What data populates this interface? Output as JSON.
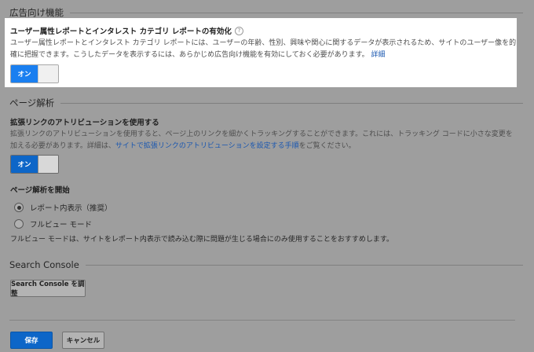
{
  "ads_section": {
    "header": "広告向け機能",
    "title": "ユーザー属性レポートとインタレスト カテゴリ レポートの有効化",
    "help_glyph": "?",
    "description": "ユーザー属性レポートとインタレスト カテゴリ レポートには、ユーザーの年齢、性別、興味や関心に関するデータが表示されるため、サイトのユーザー像を的確に把握できます。こうしたデータを表示するには、あらかじめ広告向け機能を有効にしておく必要があります。",
    "link": "詳細",
    "toggle_label": "オン"
  },
  "page_analytics": {
    "header": "ページ解析",
    "enhanced_link": {
      "title": "拡張リンクのアトリビューションを使用する",
      "description_before": "拡張リンクのアトリビューションを使用すると、ページ上のリンクを細かくトラッキングすることができます。これには、トラッキング コードに小さな変更を加える必要があります。詳細は、",
      "link": "サイトで拡張リンクのアトリビューションを設定する手順",
      "description_after": "をご覧ください。",
      "toggle_label": "オン"
    },
    "start": {
      "title": "ページ解析を開始",
      "options": [
        {
          "label": "レポート内表示（推奨）",
          "selected": true
        },
        {
          "label": "フルビュー モード",
          "selected": false
        }
      ],
      "note": "フルビュー モードは、サイトをレポート内表示で読み込む際に問題が生じる場合にのみ使用することをおすすめします。"
    }
  },
  "search_console": {
    "header": "Search Console",
    "button": "Search Console を調整"
  },
  "footer": {
    "save": "保存",
    "cancel": "キャンセル"
  }
}
